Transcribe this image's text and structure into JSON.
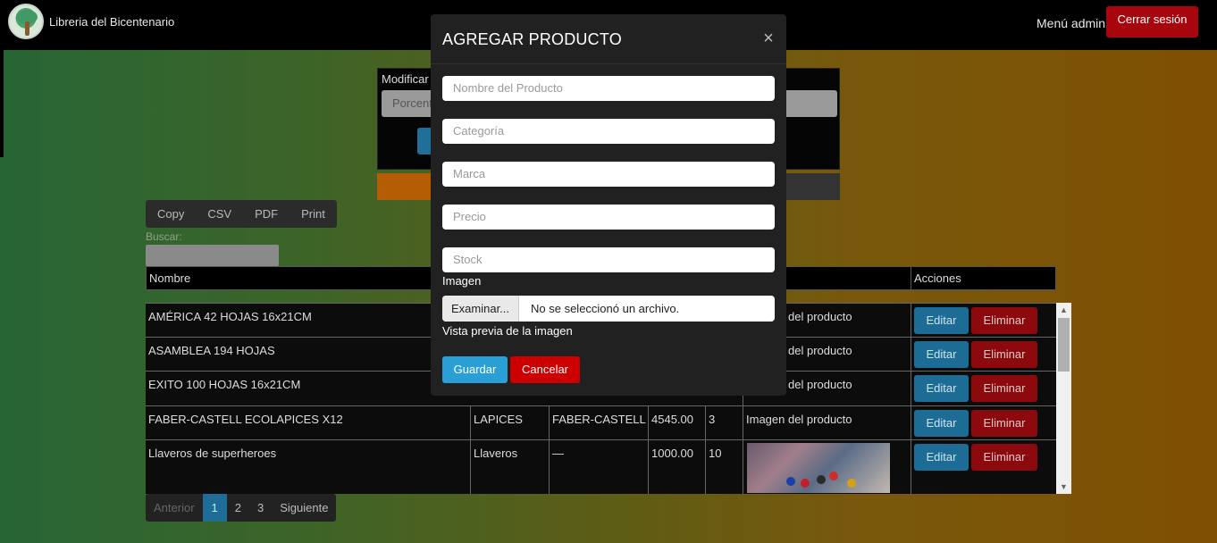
{
  "navbar": {
    "brand": "Libreria del Bicentenario",
    "admin_menu": "Menú admin",
    "logout": "Cerrar sesión"
  },
  "background_form": {
    "title": "Modificar",
    "input_placeholder": "Porcent"
  },
  "export_buttons": [
    "Copy",
    "CSV",
    "PDF",
    "Print"
  ],
  "search": {
    "label": "Buscar:"
  },
  "table": {
    "headers": {
      "name": "Nombre",
      "actions": "Acciones"
    },
    "edit_label": "Editar",
    "delete_label": "Eliminar",
    "rows": [
      {
        "name": "AMÉRICA 42 HOJAS 16x21CM",
        "category": "",
        "brand": "",
        "price": "",
        "stock": "",
        "image": "del producto"
      },
      {
        "name": "ASAMBLEA 194 HOJAS",
        "category": "",
        "brand": "",
        "price": "",
        "stock": "",
        "image": "del producto"
      },
      {
        "name": "EXITO 100 HOJAS 16x21CM",
        "category": "",
        "brand": "",
        "price": "",
        "stock": "",
        "image": "del producto"
      },
      {
        "name": "FABER-CASTELL ECOLAPICES X12",
        "category": "LAPICES",
        "brand": "FABER-CASTELL",
        "price": "4545.00",
        "stock": "3",
        "image": "Imagen del producto"
      },
      {
        "name": "Llaveros de superheroes",
        "category": "Llaveros",
        "brand": "—",
        "price": "1000.00",
        "stock": "10",
        "image": ""
      }
    ]
  },
  "pagination": {
    "prev": "Anterior",
    "pages": [
      "1",
      "2",
      "3"
    ],
    "next": "Siguiente",
    "active_page": "1"
  },
  "modal": {
    "title": "AGREGAR PRODUCTO",
    "close_glyph": "×",
    "fields": {
      "name_placeholder": "Nombre del Producto",
      "category_placeholder": "Categoría",
      "brand_placeholder": "Marca",
      "price_placeholder": "Precio",
      "stock_placeholder": "Stock"
    },
    "image_label": "Imagen",
    "file_button": "Examinar...",
    "file_status": "No se seleccionó un archivo.",
    "preview_label": "Vista previa de la imagen",
    "save": "Guardar",
    "cancel": "Cancelar"
  },
  "colors": {
    "save": "#2a9fd6",
    "cancel": "#cc0000",
    "logout": "#a8060e",
    "edit": "#1d6c96",
    "delete": "#8c0a0e"
  }
}
